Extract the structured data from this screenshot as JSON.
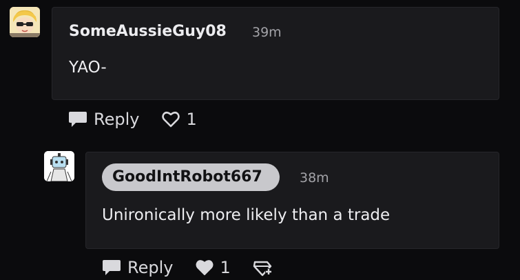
{
  "comments": [
    {
      "username": "SomeAussieGuy08",
      "time": "39m",
      "text": "YAO-",
      "reply_label": "Reply",
      "likes": "1",
      "liked": false
    },
    {
      "username": "GoodIntRobot667",
      "time": "38m",
      "text": "Unironically more likely than a trade",
      "reply_label": "Reply",
      "likes": "1",
      "liked": true,
      "is_op": true
    }
  ],
  "colors": {
    "background": "#0b0b0d",
    "bubble": "#1a1a1d",
    "op_pill": "#c8c8cc",
    "muted_text": "#a3a3a8"
  },
  "icons": {
    "reply": "speech-bubble-icon",
    "like_outline": "heart-outline-icon",
    "like_filled": "heart-filled-icon",
    "award": "gem-plus-icon"
  }
}
